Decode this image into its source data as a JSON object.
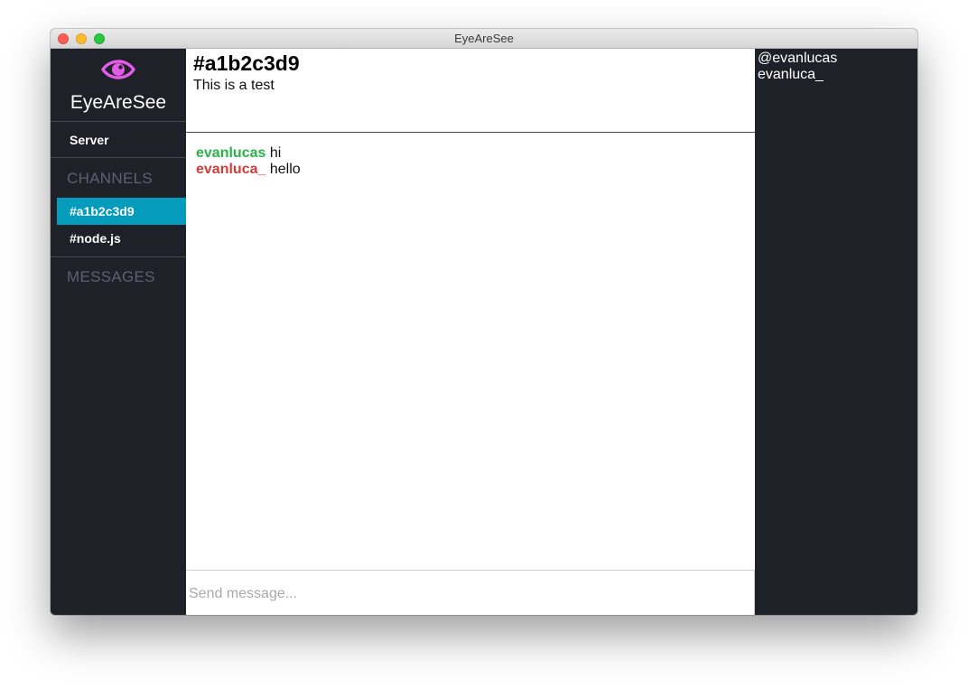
{
  "window": {
    "title": "EyeAreSee"
  },
  "sidebar": {
    "logo_icon": "eye-icon",
    "app_name": "EyeAreSee",
    "server_label": "Server",
    "channels_title": "CHANNELS",
    "channels": [
      {
        "label": "#a1b2c3d9",
        "active": true
      },
      {
        "label": "#node.js",
        "active": false
      }
    ],
    "messages_title": "MESSAGES"
  },
  "main": {
    "channel_name": "#a1b2c3d9",
    "topic": "This is a test",
    "messages": [
      {
        "nick": "evanlucas",
        "text": "hi",
        "nick_color": "#2eb24a"
      },
      {
        "nick": "evanluca_",
        "text": "hello",
        "nick_color": "#d13c3c"
      }
    ],
    "composer": {
      "placeholder": "Send message...",
      "value": ""
    }
  },
  "users": [
    "@evanlucas",
    "evanluca_"
  ],
  "colors": {
    "sidebar_bg": "#1f2129",
    "accent": "#049bbd",
    "logo": "#e35ce8",
    "section_title": "#5d6172"
  }
}
